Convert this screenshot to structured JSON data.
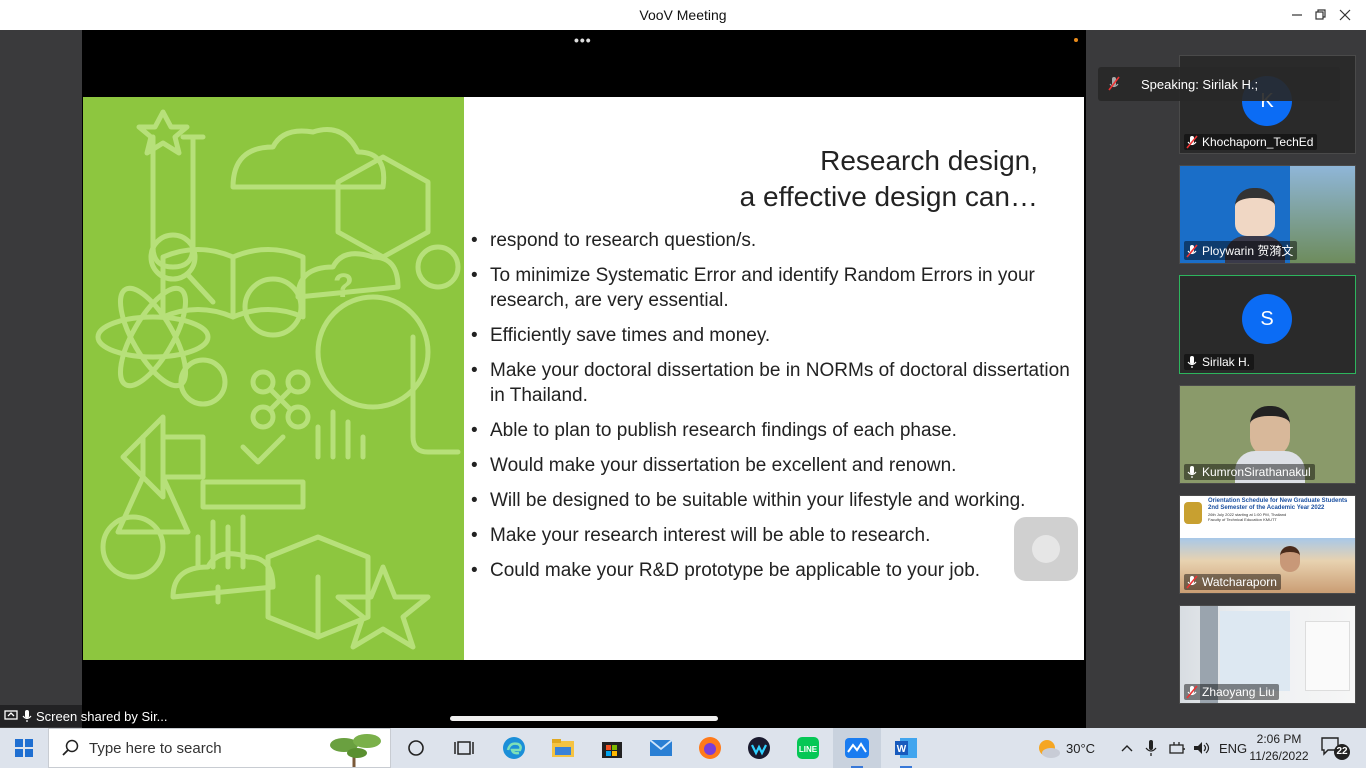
{
  "window": {
    "title": "VooV Meeting"
  },
  "share": {
    "label": "Screen shared by Sir..."
  },
  "slide": {
    "title_line1": "Research design,",
    "title_line2": "a effective design can…",
    "bullets": [
      "respond to research question/s.",
      "To minimize Systematic Error and identify Random Errors in your research, are very essential.",
      "Efficiently save times and money.",
      "Make your doctoral dissertation be in NORMs of doctoral dissertation in Thailand.",
      "Able to plan to publish research findings of each phase.",
      "Would make your dissertation be excellent and renown.",
      "Will be designed to be suitable within your lifestyle and working.",
      "Make your research interest will be able to research.",
      "Could make your R&D prototype  be applicable to your job."
    ]
  },
  "speaking": {
    "text": "Speaking: Sirilak H.;"
  },
  "participants": [
    {
      "name": "Khochaporn_TechEd",
      "avatar_letter": "K",
      "mic": "muted"
    },
    {
      "name": "Ploywarin 贺漪文",
      "mic": "muted"
    },
    {
      "name": "Sirilak H.",
      "avatar_letter": "S",
      "mic": "on"
    },
    {
      "name": "KumronSirathanakul",
      "mic": "on"
    },
    {
      "name": "Watcharaporn",
      "mic": "muted"
    },
    {
      "name": "Zhaoyang Liu",
      "mic": "muted"
    }
  ],
  "tile5_banner": {
    "line1": "Orientation Schedule for New Graduate Students",
    "line2": "2nd Semester of the Academic Year 2022",
    "line3": "26th July 2022 starting at 1:00 PM, Thailand",
    "line4": "Faculty of Technical Education KMUTT"
  },
  "taskbar": {
    "search_placeholder": "Type here to search",
    "weather": "30°C",
    "language": "ENG",
    "time": "2:06 PM",
    "date": "11/26/2022",
    "notifications": "22"
  },
  "colors": {
    "accent_green": "#2db55d",
    "avatar_blue": "#0b6cf5",
    "slide_green": "#8dc63f"
  }
}
